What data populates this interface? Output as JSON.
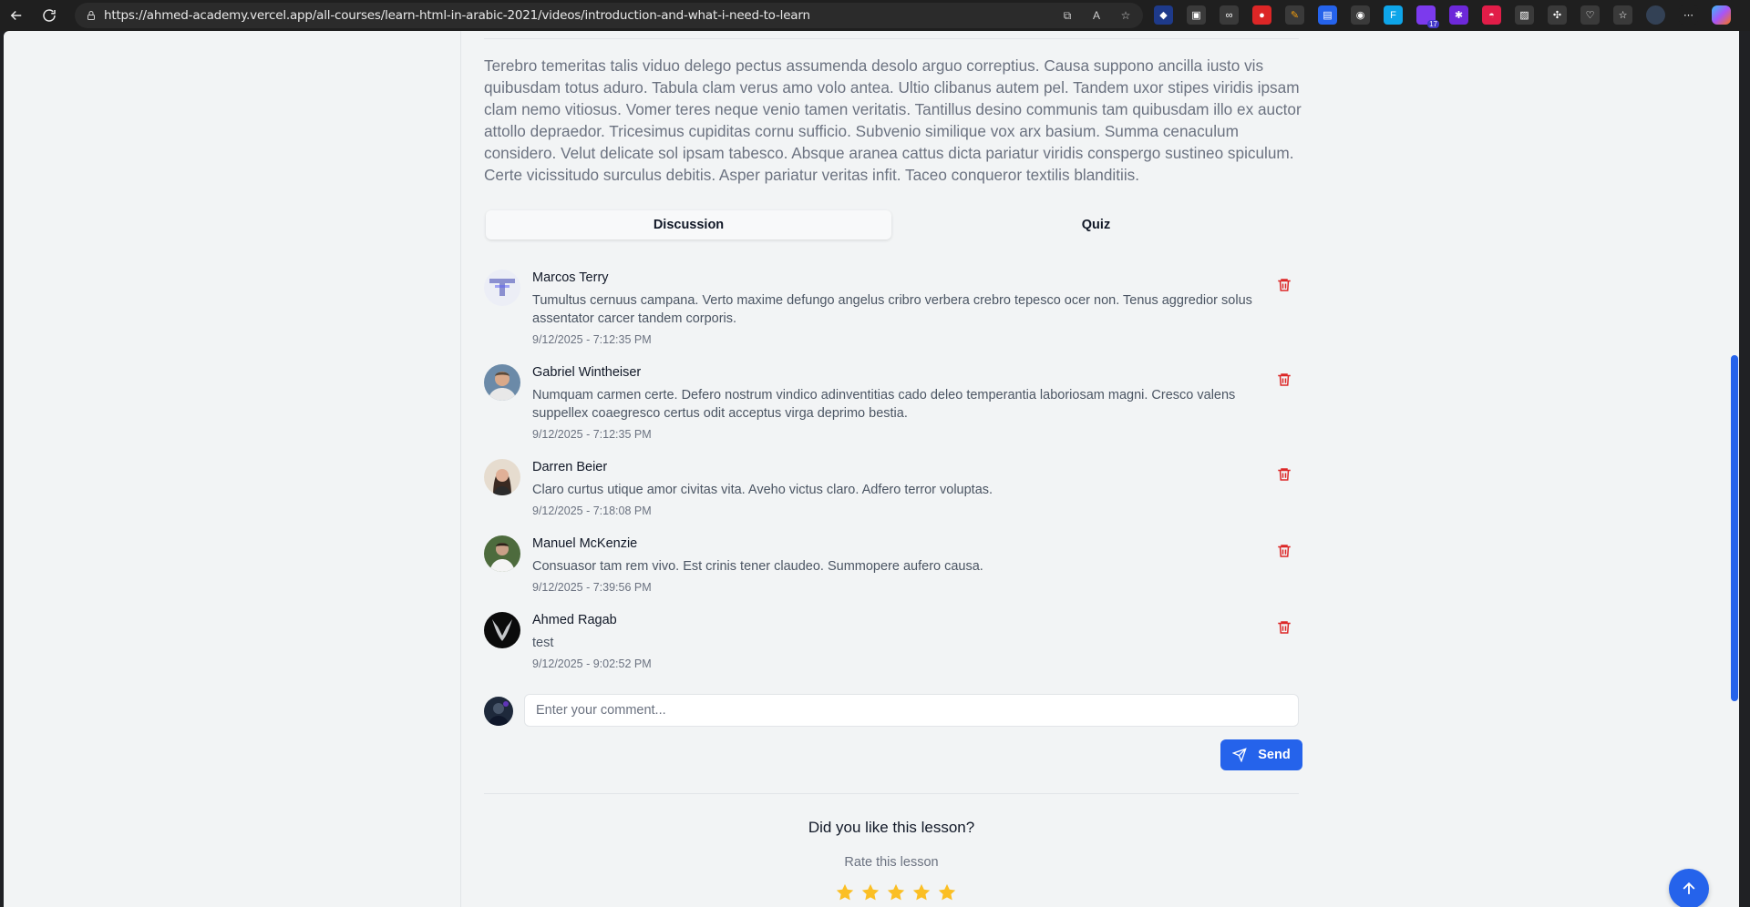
{
  "browser": {
    "url": "https://ahmed-academy.vercel.app/all-courses/learn-html-in-arabic-2021/videos/introduction-and-what-i-need-to-learn",
    "extension_badge": "17"
  },
  "lesson": {
    "description": "Terebro temeritas talis viduo delego pectus assumenda desolo arguo correptius. Causa suppono ancilla iusto vis quibusdam totus aduro. Tabula clam verus amo volo antea. Ultio clibanus autem pel. Tandem uxor stipes viridis ipsam clam nemo vitiosus. Vomer teres neque venio tamen veritatis. Tantillus desino communis tam quibusdam illo ex auctor attollo depraedor. Tricesimus cupiditas cornu sufficio. Subvenio similique vox arx basium. Summa cenaculum considero. Velut delicate sol ipsam tabesco. Absque aranea cattus dicta pariatur viridis conspergo sustineo spiculum. Certe vicissitudo surculus debitis. Asper pariatur veritas infit. Taceo conqueror textilis blanditiis."
  },
  "tabs": [
    {
      "label": "Discussion",
      "active": true
    },
    {
      "label": "Quiz",
      "active": false
    }
  ],
  "comments": [
    {
      "name": "Marcos Terry",
      "text": "Tumultus cernuus campana. Verto maxime defungo angelus cribro verbera crebro tepesco ocer non. Tenus aggredior solus assentator carcer tandem corporis.",
      "time": "9/12/2025 - 7:12:35 PM"
    },
    {
      "name": "Gabriel Wintheiser",
      "text": "Numquam carmen certe. Defero nostrum vindico adinventitias cado deleo temperantia laboriosam magni. Cresco valens suppellex coaegresco certus odit acceptus virga deprimo bestia.",
      "time": "9/12/2025 - 7:12:35 PM"
    },
    {
      "name": "Darren Beier",
      "text": "Claro curtus utique amor civitas vita. Aveho victus claro. Adfero terror voluptas.",
      "time": "9/12/2025 - 7:18:08 PM"
    },
    {
      "name": "Manuel McKenzie",
      "text": "Consuasor tam rem vivo. Est crinis tener claudeo. Summopere aufero causa.",
      "time": "9/12/2025 - 7:39:56 PM"
    },
    {
      "name": "Ahmed Ragab",
      "text": "test",
      "time": "9/12/2025 - 9:02:52 PM"
    }
  ],
  "comment_form": {
    "placeholder": "Enter your comment...",
    "value": "",
    "send_label": "Send"
  },
  "rating": {
    "question": "Did you like this lesson?",
    "subtitle": "Rate this lesson",
    "stars": 5,
    "star_color": "#fbbf24"
  },
  "colors": {
    "accent": "#2563eb",
    "danger": "#dc2626"
  }
}
